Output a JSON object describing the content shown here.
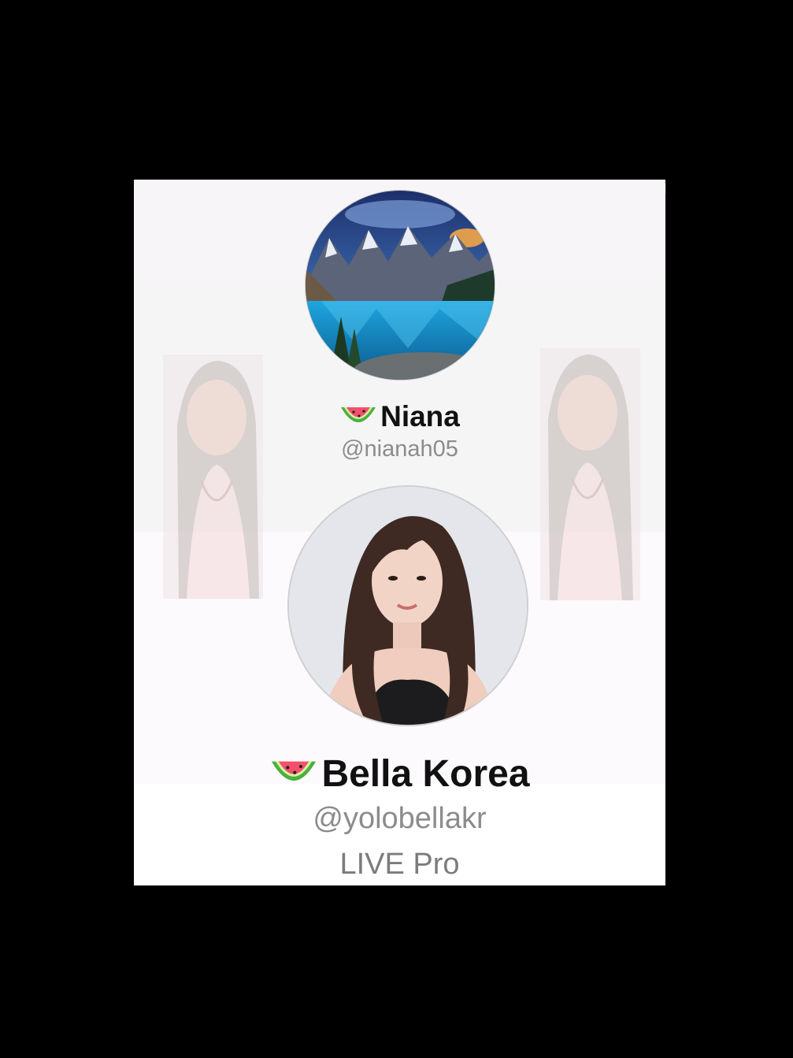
{
  "profiles": [
    {
      "icon": "watermelon-icon",
      "name": "Niana",
      "handle": "@nianah05",
      "avatar": "mountain-lake-photo"
    },
    {
      "icon": "watermelon-icon",
      "name": "Bella Korea",
      "handle": "@yolobellakr",
      "badge": "LIVE Pro",
      "avatar": "portrait-photo"
    }
  ],
  "colors": {
    "background": "#000000",
    "panel": "#ffffff",
    "name": "#111111",
    "handle": "#8c8c8c"
  }
}
